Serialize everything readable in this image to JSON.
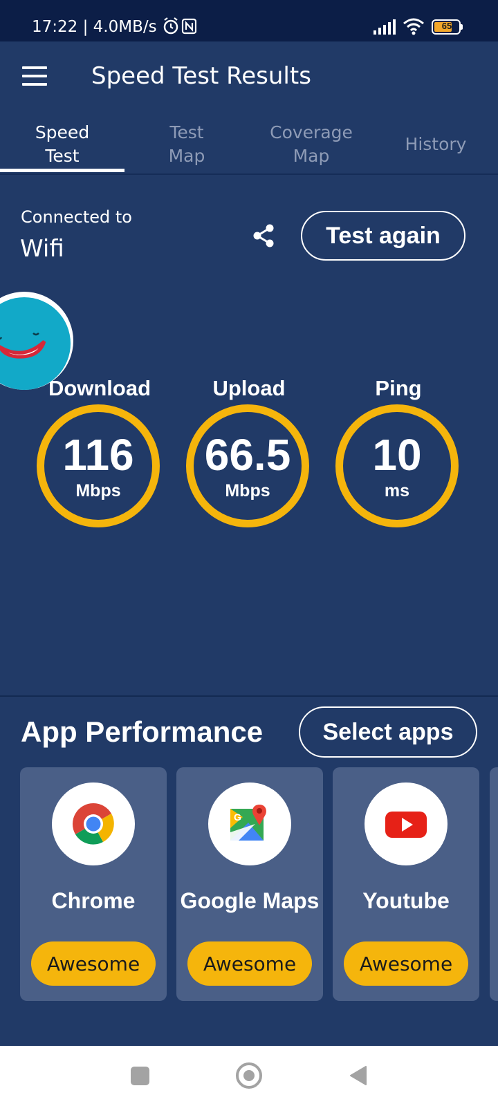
{
  "status_bar": {
    "text": "17:22 | 4.0MB/s",
    "battery_level": "65",
    "icons": [
      "alarm-icon",
      "nfc-icon",
      "signal-icon",
      "wifi-icon",
      "battery-icon"
    ]
  },
  "app_bar": {
    "title": "Speed Test Results",
    "menu_icon": "menu-icon"
  },
  "tabs": [
    {
      "label": "Speed\nTest",
      "active": true
    },
    {
      "label": "Test\nMap",
      "active": false
    },
    {
      "label": "Coverage\nMap",
      "active": false
    },
    {
      "label": "History",
      "active": false
    }
  ],
  "connection": {
    "label": "Connected to",
    "value": "Wifi",
    "share_icon": "share-icon",
    "test_again_label": "Test again"
  },
  "metrics": [
    {
      "label": "Download",
      "value": "116",
      "unit": "Mbps"
    },
    {
      "label": "Upload",
      "value": "66.5",
      "unit": "Mbps"
    },
    {
      "label": "Ping",
      "value": "10",
      "unit": "ms"
    }
  ],
  "app_performance": {
    "title": "App Performance",
    "select_apps_label": "Select apps",
    "apps": [
      {
        "name": "Chrome",
        "rating": "Awesome",
        "icon": "chrome-icon"
      },
      {
        "name": "Google Maps",
        "rating": "Awesome",
        "icon": "google-maps-icon"
      },
      {
        "name": "Youtube",
        "rating": "Awesome",
        "icon": "youtube-icon"
      }
    ]
  },
  "colors": {
    "background": "#213a67",
    "status_bar": "#0c1e47",
    "accent": "#f5b50c",
    "card": "#4a5f87"
  },
  "nav_bar": {
    "icons": [
      "recent-apps-icon",
      "home-icon",
      "back-icon"
    ]
  }
}
